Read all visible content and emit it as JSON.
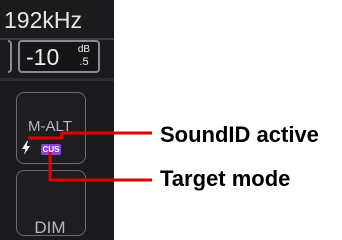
{
  "header": {
    "sample_rate": "192kHz"
  },
  "trim": {
    "value": "-10",
    "unit": "dB",
    "sub": ".5"
  },
  "monitor_buttons": {
    "malt_label": "M-ALT",
    "mode_badge": "CUS",
    "dim_label": "DIM"
  },
  "annotations": {
    "soundid_active": "SoundID active",
    "target_mode": "Target mode",
    "line_color": "#e00000"
  },
  "colors": {
    "panel_background": "#1b1b1d",
    "badge_purple": "#8b44d6",
    "text_light": "#e8e8e8"
  },
  "icons": {
    "bolt": "lightning-bolt-icon"
  }
}
